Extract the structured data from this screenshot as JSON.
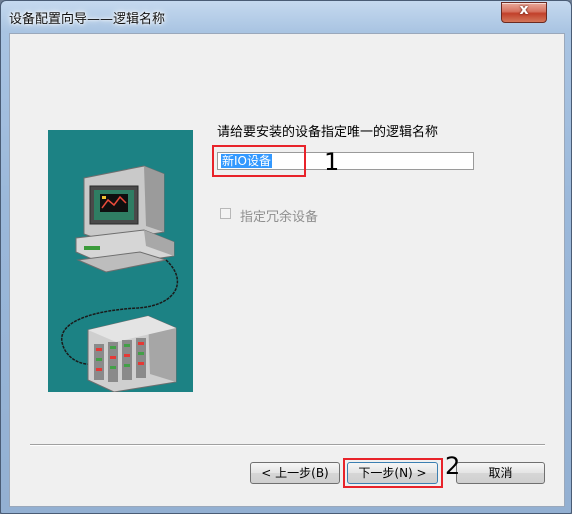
{
  "window": {
    "title": "设备配置向导——逻辑名称",
    "close_glyph": "x"
  },
  "main": {
    "prompt": "请给要安装的设备指定唯一的逻辑名称",
    "name_input_value": "新IO设备",
    "redundant_label": "指定冗余设备",
    "redundant_checked": false
  },
  "buttons": {
    "back": "< 上一步(B)",
    "next": "下一步(N) >",
    "cancel": "取消"
  },
  "annotations": {
    "callout_1": "1",
    "callout_2": "2",
    "callout_color": "#e8232a"
  },
  "illustration": {
    "description_icons": [
      "computer-icon",
      "device-rack-icon"
    ],
    "background_color": "#1c8284"
  }
}
